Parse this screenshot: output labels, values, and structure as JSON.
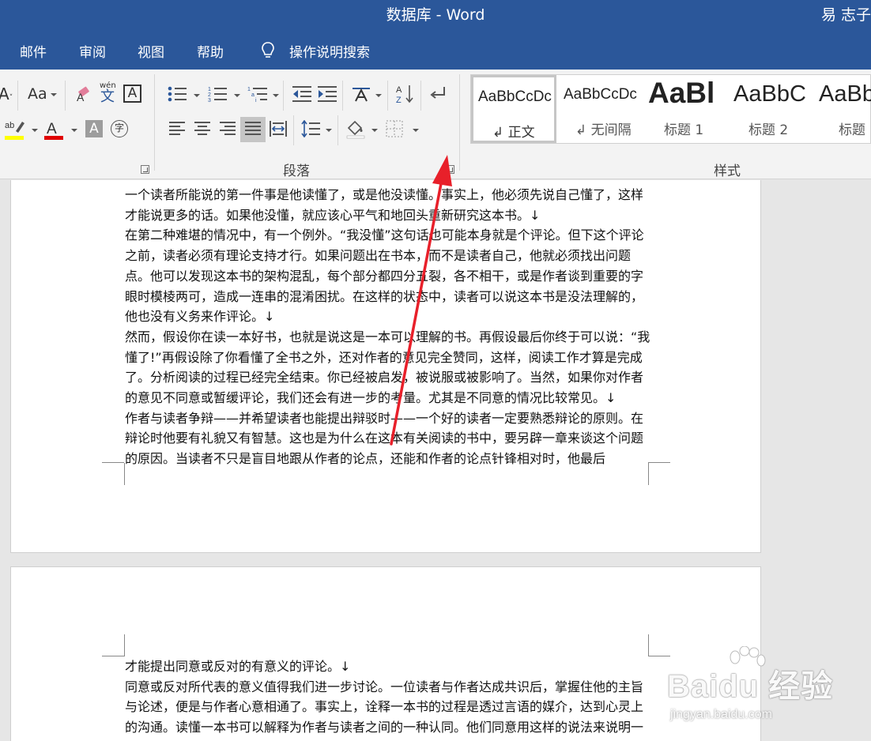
{
  "window": {
    "title": "数据库  -  Word",
    "user": "易 志子"
  },
  "tabs": [
    {
      "label": "邮件"
    },
    {
      "label": "审阅"
    },
    {
      "label": "视图"
    },
    {
      "label": "帮助"
    }
  ],
  "tell_me": "操作说明搜索",
  "ribbon": {
    "font_group": {
      "case_label": "Aa",
      "phonetic_top": "wén",
      "phonetic_bottom": "文",
      "char_border": "A",
      "encircle": "字",
      "highlight_color": "#ffff00",
      "font_color": "#e00000"
    },
    "paragraph_group": {
      "label": "段落"
    },
    "styles_group": {
      "label": "样式",
      "items": [
        {
          "sample": "AaBbCcDc",
          "name": "↲ 正文"
        },
        {
          "sample": "AaBbCcDc",
          "name": "↲ 无间隔"
        },
        {
          "sample": "AaBl",
          "name": "标题 1"
        },
        {
          "sample": "AaBbC",
          "name": "标题 2"
        },
        {
          "sample": "AaBb",
          "name": "标题"
        }
      ]
    }
  },
  "page1": {
    "paragraphs": [
      "一个读者所能说的第一件事是他读懂了，或是他没读懂。事实上，他必须先说自己懂了，这样才能说更多的话。如果他没懂，就应该心平气和地回头重新研究这本书。↓",
      "在第二种难堪的情况中，有一个例外。“我没懂”这句话也可能本身就是个评论。但下这个评论之前，读者必须有理论支持才行。如果问题出在书本，而不是读者自己，他就必须找出问题点。他可以发现这本书的架构混乱，每个部分都四分五裂，各不相干，或是作者谈到重要的字眼时模棱两可，造成一连串的混淆困扰。在这样的状态中，读者可以说这本书是没法理解的，他也没有义务来作评论。↓",
      "然而，假设你在读一本好书，也就是说这是一本可以理解的书。再假设最后你终于可以说：“我懂了!”再假设除了你看懂了全书之外，还对作者的意见完全赞同，这样，阅读工作才算是完成了。分析阅读的过程已经完全结束。你已经被启发，被说服或被影响了。当然，如果你对作者的意见不同意或暂缓评论，我们还会有进一步的考量。尤其是不同意的情况比较常见。↓",
      "作者与读者争辩——并希望读者也能提出辩驳时——一个好的读者一定要熟悉辩论的原则。在辩论时他要有礼貌又有智慧。这也是为什么在这本有关阅读的书中，要另辟一章来谈这个问题的原因。当读者不只是盲目地跟从作者的论点，还能和作者的论点针锋相对时，他最后"
    ]
  },
  "page2": {
    "paragraphs": [
      "才能提出同意或反对的有意义的评论。↓",
      "同意或反对所代表的意义值得我们进一步讨论。一位读者与作者达成共识后，掌握住他的主旨与论述，便是与作者心意相通了。事实上，诠释一本书的过程是透过言语的媒介，达到心灵上的沟通。读懂一本书可以解释为作者与读者之间的一种认同。他们同意用这样的说法来说明一种想法。因为这样的认同，读者才能透过作者所用的语言，看出他想要表达的想法。"
    ]
  },
  "watermark": {
    "brand": "Baidu 经验",
    "url": "jingyan.baidu.com"
  }
}
